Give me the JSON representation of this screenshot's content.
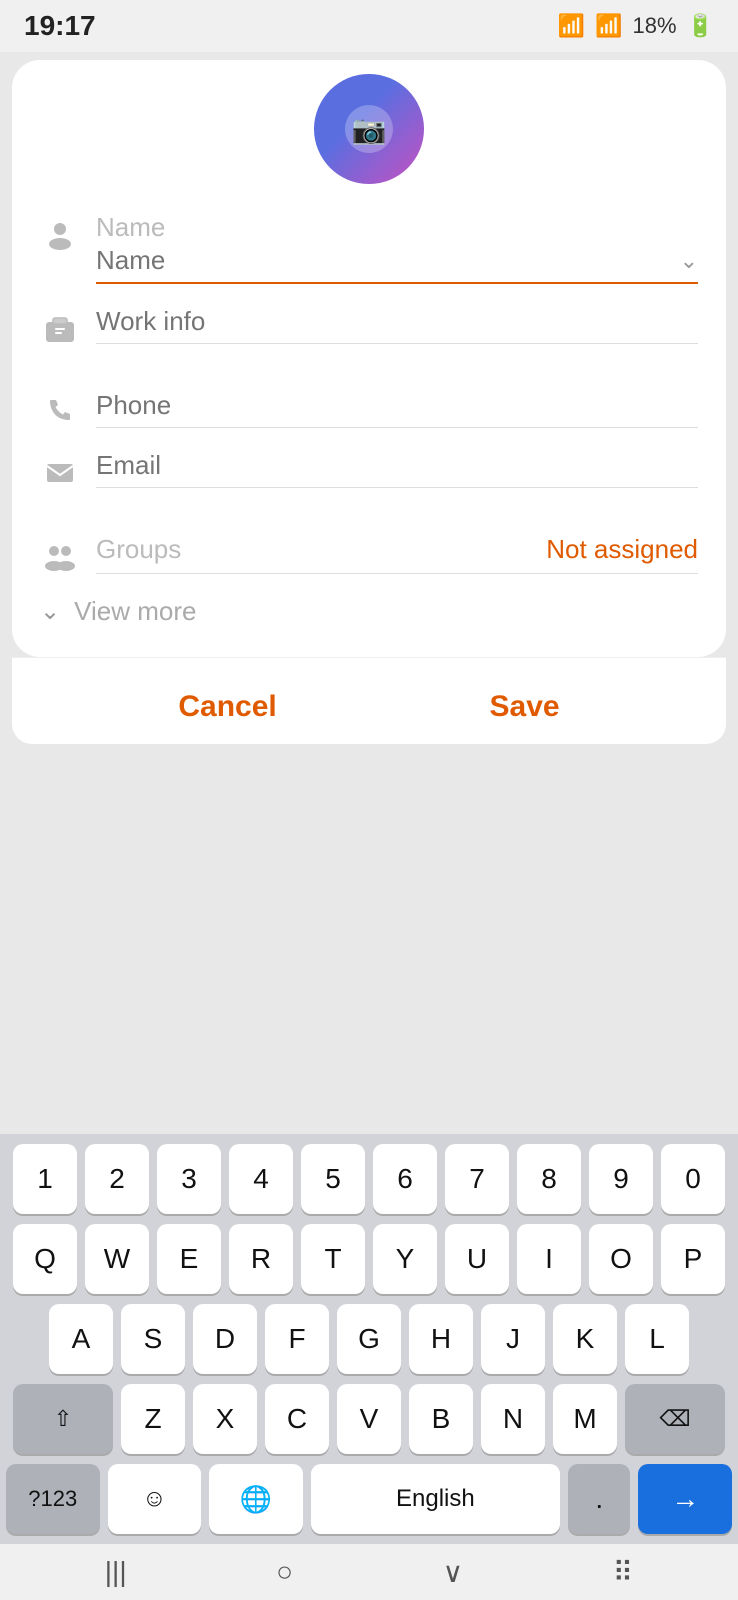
{
  "statusBar": {
    "time": "19:17",
    "battery": "18%",
    "wifi": "wifi",
    "signal1": "signal",
    "signal2": "signal"
  },
  "avatar": {
    "cameraIcon": "📷"
  },
  "form": {
    "nameLabel": "Name",
    "namePlaceholder": "Name",
    "workInfoLabel": "Work info",
    "workInfoPlaceholder": "",
    "phonePlaceholder": "Phone",
    "emailPlaceholder": "Email",
    "groupsLabel": "Groups",
    "groupsValue": "Not assigned",
    "viewMoreLabel": "View more"
  },
  "actions": {
    "cancelLabel": "Cancel",
    "saveLabel": "Save"
  },
  "keyboard": {
    "row1": [
      "1",
      "2",
      "3",
      "4",
      "5",
      "6",
      "7",
      "8",
      "9",
      "0"
    ],
    "row2": [
      "Q",
      "W",
      "E",
      "R",
      "T",
      "Y",
      "U",
      "I",
      "O",
      "P"
    ],
    "row3": [
      "A",
      "S",
      "D",
      "F",
      "G",
      "H",
      "J",
      "K",
      "L"
    ],
    "row4": [
      "Z",
      "X",
      "C",
      "V",
      "B",
      "N",
      "M"
    ],
    "spacebarLabel": "English",
    "symbolsLabel": "?123",
    "emojiLabel": "☺",
    "globeLabel": "🌐",
    "backspaceLabel": "⌫",
    "shiftLabel": "⇧",
    "enterLabel": "→"
  },
  "navBar": {
    "back": "|||",
    "home": "○",
    "recent": "∨",
    "apps": "⠿"
  }
}
